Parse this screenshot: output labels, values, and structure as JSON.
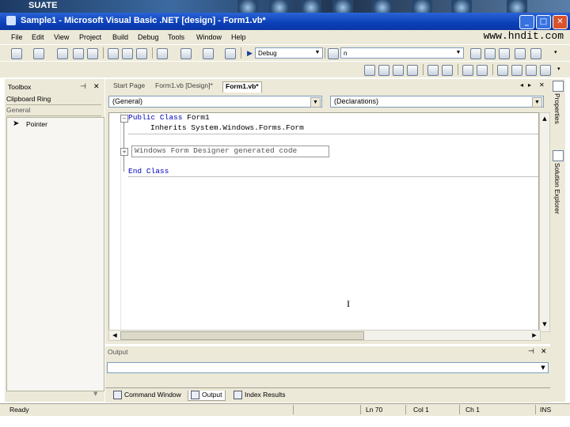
{
  "banner": {
    "logo": "SUATE",
    "tagline": ""
  },
  "window": {
    "title": "Sample1 - Microsoft Visual Basic .NET [design] - Form1.vb*"
  },
  "watermark": "www.hndit.com",
  "menu": [
    "File",
    "Edit",
    "View",
    "Project",
    "Build",
    "Debug",
    "Tools",
    "Window",
    "Help"
  ],
  "toolbar": {
    "config": "Debug",
    "find_value": "n"
  },
  "toolbox": {
    "title": "Toolbox",
    "tabs": [
      "Clipboard Ring",
      "General"
    ],
    "items": [
      "Pointer"
    ]
  },
  "editor": {
    "tabs": [
      "Start Page",
      "Form1.vb [Design]*",
      "Form1.vb*"
    ],
    "class_select": "(General)",
    "method_select": "(Declarations)",
    "code": {
      "line1_kw1": "Public",
      "line1_kw2": "Class",
      "line1_name": "Form1",
      "line2": "Inherits System.Windows.Forms.Form",
      "region": "Windows Form Designer generated code",
      "end_kw1": "End",
      "end_kw2": "Class"
    }
  },
  "side": {
    "properties": "Properties",
    "solution_explorer": "Solution Explorer"
  },
  "output": {
    "title": "Output"
  },
  "bottom_tabs": [
    "Command Window",
    "Output",
    "Index Results"
  ],
  "status": {
    "state": "Ready",
    "line": "Ln 70",
    "col": "Col 1",
    "ch": "Ch 1",
    "ins": "INS"
  }
}
